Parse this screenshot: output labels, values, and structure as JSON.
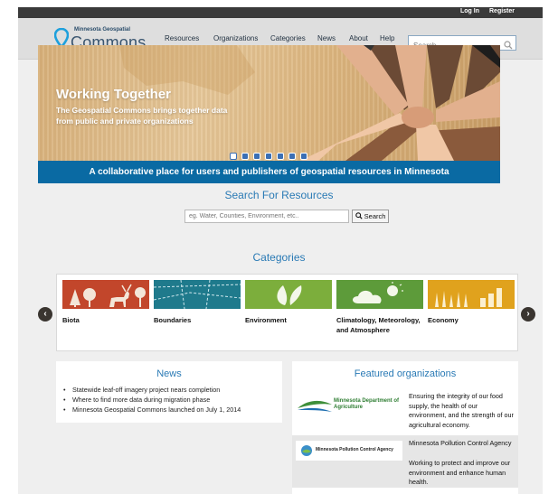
{
  "topbar": {
    "login": "Log In",
    "register": "Register"
  },
  "logo": {
    "small": "Minnesota Geospatial",
    "big": "Commons"
  },
  "nav": [
    "Resources",
    "Organizations",
    "Categories",
    "News",
    "About",
    "Help"
  ],
  "search": {
    "placeholder": "Search"
  },
  "hero": {
    "title": "Working Together",
    "text": "The Geospatial Commons brings together data from public and private organizations",
    "slide_count": 7,
    "active_slide": 1
  },
  "banner": "A collaborative place for users and publishers of geospatial resources in Minnesota",
  "search_resources": {
    "title": "Search For Resources",
    "placeholder": "eg. Water, Counties, Environment, etc..",
    "button": "Search"
  },
  "categories": {
    "title": "Categories",
    "items": [
      {
        "label": "Biota",
        "color": "#c2462b"
      },
      {
        "label": "Boundaries",
        "color": "#1f7a8c"
      },
      {
        "label": "Environment",
        "color": "#7cae3c"
      },
      {
        "label": "Climatology, Meteorology, and Atmosphere",
        "color": "#5d9b3a"
      },
      {
        "label": "Economy",
        "color": "#e0a21d"
      }
    ]
  },
  "news": {
    "title": "News",
    "items": [
      "Statewide leaf-off imagery project nears completion",
      "Where to find more data during migration phase",
      "Minnesota Geospatial Commons launched on July 1, 2014"
    ]
  },
  "featured": {
    "title": "Featured organizations",
    "orgs": [
      {
        "logo_text": "Minnesota Department of Agriculture",
        "name": "",
        "description": "Ensuring the integrity of our food supply, the health of our environment, and the strength of our agricultural economy."
      },
      {
        "logo_text": "Minnesota Pollution Control Agency",
        "name": "Minnesota Pollution Control Agency",
        "description": "Working to protect and improve our environment and enhance human health."
      }
    ]
  }
}
